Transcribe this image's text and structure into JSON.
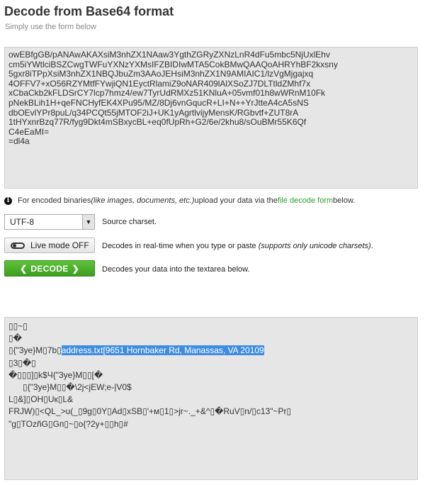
{
  "header": {
    "title": "Decode from Base64 format",
    "subtitle": "Simply use the form below"
  },
  "source_text": {
    "lines": [
      "owEBfgGB/pANAwAKAXsiM3nhZX1NAaw3YgthZGRyZXNzLnR4dFu5mbc5NjUxlEhv",
      "cm5iYWtlciBSZCwgTWFuYXNzYXMsIFZBIDIwMTA5CokBMwQAAQoAHRYhBF2kxsny",
      "5gxr8iTPpXsiM3nhZX1NBQJbuZm3AAoJEHsiM3nhZX1N9AMIAIC1/lzVgMjgajxq",
      "4OFFV7+xO56RZYMtfFYwjiQN1EyctRlamiZ9oNAR409lAlXSoZJ7DLTtldZMhf7x",
      "xCbaCkb2kFLDSrCY7lcp7hmz4/ew7TyrUdRMXz51KNluA+05vmf01h8wWRnM10Fk",
      "pNekBLih1H+qeFNCHyfEK4XPu95/MZ/8Dj6vnGqucR+LI+N++YrJtteA4cA5sNS",
      "dbOEvlYPr8puL/q34PCQt55jMTOF2iJ+UK1yAgrtlvijyMensK/RGbvtf+ZUT8rA",
      "1tHYxnrBzq77R/fyg9Dkt4mSBxycBL+eq0fUpRh+G2/6e/2khu8/sOuBMr55K6Qf",
      "C4eEaMI=",
      "=dl4a"
    ]
  },
  "info": {
    "prefix": "For encoded binaries ",
    "emphasis": "(like images, documents, etc.)",
    "middle": " upload your data via the ",
    "link": "file decode form",
    "suffix": " below."
  },
  "charset": {
    "selected": "UTF-8",
    "label": "Source charset."
  },
  "live_mode": {
    "button_label": "Live mode OFF",
    "description": "Decodes in real-time when you type or paste ",
    "description_em": "(supports only unicode charsets)",
    "description_end": "."
  },
  "decode": {
    "button_label": "DECODE",
    "description": "Decodes your data into the textarea below."
  },
  "output_text": {
    "line1": "▯▯~▯",
    "line2": "▯�",
    "line3_prefix": "▯{\"3ye}M▯7b▯",
    "line3_highlight": "address.txt[9651 Hornbaker Rd, Manassas, VA 20109",
    "line4": "▯3▯�▯",
    "line5": "�▯▯▯]▯k$Ч{\"3ye}M▯▯[�",
    "line6": "▯{\"3ye}M▯▯�\\2j<jEW;e-|V0$",
    "line7": "L▯&]▯OH▯Uк▯L&",
    "line8": "FRJW)▯<QL_>u(_▯9g▯0Y▯Ad▯xSB▯'+м▯1▯>jr~._+&^▯�RuV▯n/▯c13\"~Pr▯",
    "line9": "\"g▯TOzñG▯Gп▯~▯o{?2y+▯▯h▯#"
  }
}
